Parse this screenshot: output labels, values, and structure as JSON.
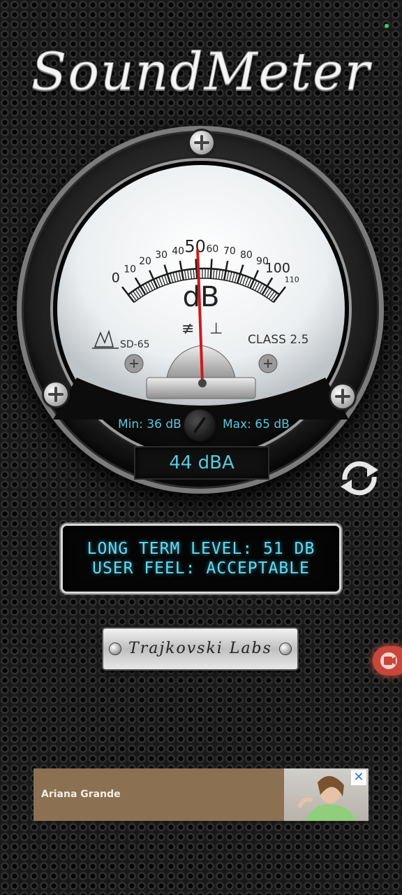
{
  "app": {
    "title": "SoundMeter"
  },
  "meter": {
    "unit": "dB",
    "scale_labels": [
      "0",
      "10",
      "20",
      "30",
      "40",
      "50",
      "60",
      "70",
      "80",
      "90",
      "100",
      "110"
    ],
    "model": "SD-65",
    "class_label": "CLASS 2.5",
    "needle_value": 52,
    "min_label": "Min: 36 dB",
    "max_label": "Max: 65 dB",
    "current_reading": "44 dBA"
  },
  "lcd": {
    "line1": "LONG TERM LEVEL: 51 DB",
    "line2": "USER FEEL: ACCEPTABLE"
  },
  "brand_plate": {
    "text": "Trajkovski Labs"
  },
  "ad": {
    "text": "Ariana Grande",
    "close_glyph": "✕"
  },
  "colors": {
    "accent": "#56c8de",
    "needle": "#cc1a1a",
    "record": "#c9463a"
  },
  "icons": {
    "refresh": "refresh-icon",
    "record": "video-record-icon"
  }
}
